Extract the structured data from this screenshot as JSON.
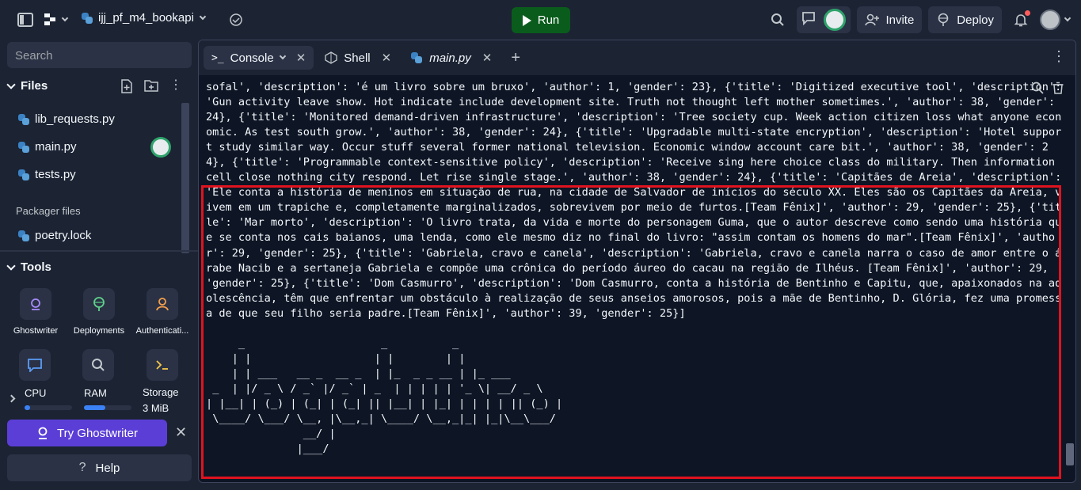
{
  "topbar": {
    "repl_name": "ijj_pf_m4_bookapi",
    "run_label": "Run",
    "invite_label": "Invite",
    "deploy_label": "Deploy"
  },
  "sidebar": {
    "search_placeholder": "Search",
    "files_header": "Files",
    "files": [
      "lib_requests.py",
      "main.py",
      "tests.py"
    ],
    "packager_header": "Packager files",
    "packager_files": [
      "poetry.lock"
    ],
    "tools_header": "Tools",
    "tools": [
      {
        "label": "Ghostwriter",
        "icon": "ghostwriter-icon"
      },
      {
        "label": "Deployments",
        "icon": "deployments-icon"
      },
      {
        "label": "Authenticati...",
        "icon": "user-icon"
      }
    ],
    "resources": {
      "cpu_label": "CPU",
      "cpu_fraction": 0.12,
      "ram_label": "RAM",
      "ram_fraction": 0.45,
      "storage_label": "Storage",
      "storage_value": "3 MiB"
    },
    "try_ghostwriter_label": "Try Ghostwriter",
    "help_label": "Help"
  },
  "tabs": [
    {
      "label": "Console",
      "active": true
    },
    {
      "label": "Shell",
      "active": false
    },
    {
      "label": "main.py",
      "active": false
    }
  ],
  "console": {
    "output": "sofal', 'description': 'é um livro sobre um bruxo', 'author': 1, 'gender': 23}, {'title': 'Digitized executive tool', 'description': 'Gun activity leave show. Hot indicate include development site. Truth not thought left mother sometimes.', 'author': 38, 'gender': 24}, {'title': 'Monitored demand-driven infrastructure', 'description': 'Tree society cup. Week action citizen loss what anyone economic. As test south grow.', 'author': 38, 'gender': 24}, {'title': 'Upgradable multi-state encryption', 'description': 'Hotel support study similar way. Occur stuff several former national television. Economic window account care bit.', 'author': 38, 'gender': 24}, {'title': 'Programmable context-sensitive policy', 'description': 'Receive sing here choice class do military. Then information cell close nothing city respond. Let rise single stage.', 'author': 38, 'gender': 24}, {'title': 'Capitães de Areia', 'description': 'Ele conta a história de meninos em situação de rua, na cidade de Salvador de inícios do século XX. Eles são os Capitães da Areia, vivem em um trapiche e, completamente marginalizados, sobrevivem por meio de furtos.[Team Fênix]', 'author': 29, 'gender': 25}, {'title': 'Mar morto', 'description': 'O livro trata, da vida e morte do personagem Guma, que o autor descreve como sendo uma história que se conta nos cais baianos, uma lenda, como ele mesmo diz no final do livro: \"assim contam os homens do mar\".[Team Fênix]', 'author': 29, 'gender': 25}, {'title': 'Gabriela, cravo e canela', 'description': 'Gabriela, cravo e canela narra o caso de amor entre o árabe Nacib e a sertaneja Gabriela e compõe uma crônica do período áureo do cacau na região de Ilhéus. [Team Fênix]', 'author': 29, 'gender': 25}, {'title': 'Dom Casmurro', 'description': 'Dom Casmurro, conta a história de Bentinho e Capitu, que, apaixonados na adolescência, têm que enfrentar um obstáculo à realização de seus anseios amorosos, pois a mãe de Bentinho, D. Glória, fez uma promessa de que seu filho seria padre.[Team Fênix]', 'author': 39, 'gender': 25}]\n\n     _                     _          _\n    | |                   | |        | |\n    | | ___   __ _  __ _  | |_  _ _ __ | |_ ___\n _  | |/ _ \\ / _` |/ _` | _  | | | | | '_ \\| __/ _ \\\n| |__| | (_) | (_| | (_| || |__| | |_| | | | | || (_) |\n \\____/ \\___/ \\__, |\\__,_| \\____/ \\__,_|_| |_|\\__\\___/\n               __/ |\n              |___/"
  },
  "colors": {
    "background": "#1c2333",
    "console_bg": "#0e1525",
    "run_green": "#0a5c1c",
    "ghostwriter_purple": "#5b3ed6",
    "highlight_red": "#e0131e"
  }
}
